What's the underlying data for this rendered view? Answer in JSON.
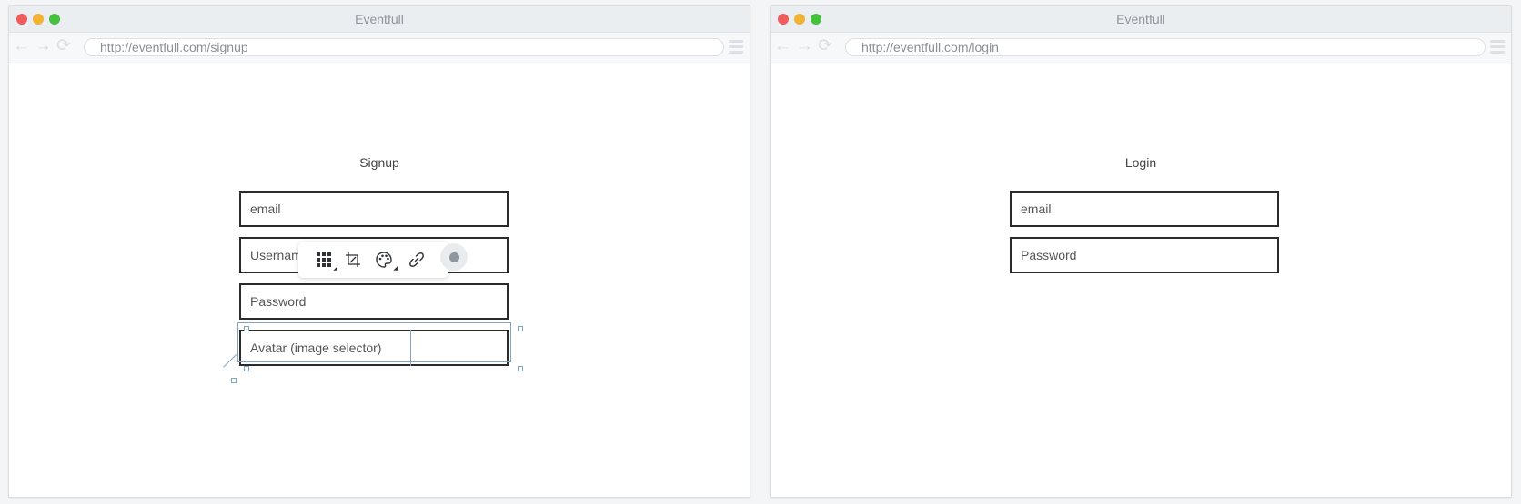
{
  "windows": {
    "signup": {
      "title": "Eventfull",
      "url": "http://eventfull.com/signup",
      "heading": "Signup",
      "fields": {
        "email": "email",
        "username": "Usernam",
        "password": "Password",
        "avatar": "Avatar (image selector)"
      }
    },
    "login": {
      "title": "Eventfull",
      "url": "http://eventfull.com/login",
      "heading": "Login",
      "fields": {
        "email": "email",
        "password": "Password"
      }
    }
  },
  "toolbar": {
    "tools": [
      "grid-icon",
      "crop-icon",
      "palette-icon",
      "link-icon",
      "more-icon"
    ],
    "status_indicator": "status-dot-icon"
  },
  "colors": {
    "selection": "#7ea5c6",
    "field_border": "#2b2b2b",
    "traffic_red": "#f25b5b",
    "traffic_yellow": "#f2b233",
    "traffic_green": "#45c23d"
  }
}
